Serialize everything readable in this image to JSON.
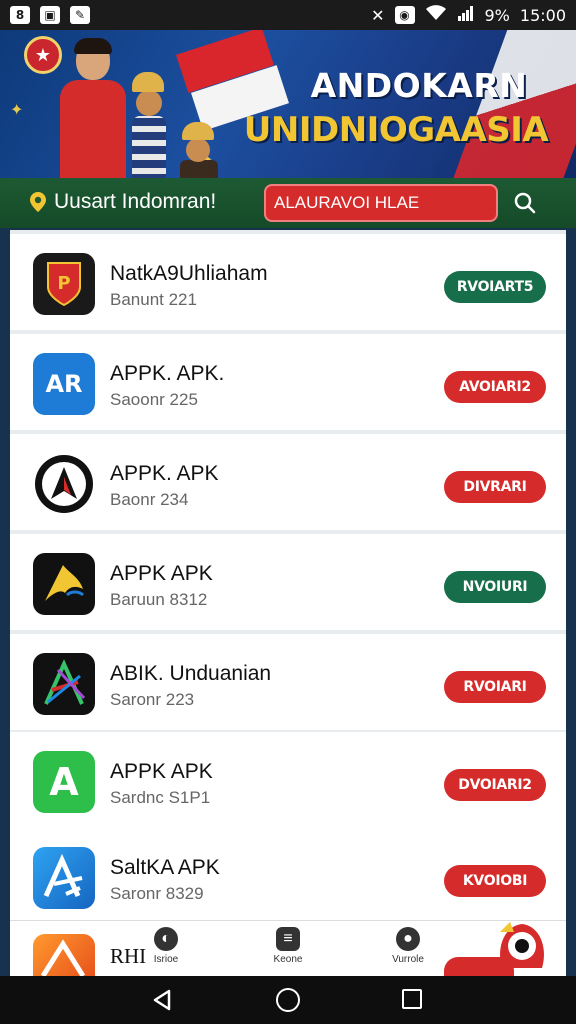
{
  "status_bar": {
    "right_text": "9%",
    "time": "15:00",
    "left_icons": [
      "notification-icon",
      "image-icon",
      "edit-icon"
    ],
    "right_icons": [
      "mute-icon",
      "alarm-icon",
      "wifi-icon",
      "signal-icon"
    ]
  },
  "banner": {
    "title_line1": "ANDOKARN",
    "title_line2": "UNIDNIOGAASIA"
  },
  "search_bar": {
    "greeting": "Uusart Indomran!",
    "search_value": "ALAURAVOI HLAE",
    "location_icon": "location-pin-icon",
    "search_icon": "search-icon"
  },
  "apps": [
    {
      "name": "NatkA9Uhliaham",
      "subtitle": "Banunt 221",
      "button": "RVOIART5",
      "button_color": "#176e4a",
      "icon_bg": "#1a1a1a",
      "icon_fg": "#d62b2b",
      "icon_glyph": "P"
    },
    {
      "name": "APPK. APK.",
      "subtitle": "Saoonr 225",
      "button": "AVOIARI2",
      "button_color": "#d62b2b",
      "icon_bg": "#1e7bd6",
      "icon_fg": "#ffffff",
      "icon_glyph": "AR"
    },
    {
      "name": "APPK. APK",
      "subtitle": "Baonr 234",
      "button": "DIVRARI",
      "button_color": "#d62b2b",
      "icon_bg": "#ffffff",
      "icon_fg": "#111111",
      "icon_glyph": "A"
    },
    {
      "name": "APPK APK",
      "subtitle": "Baruun 8312",
      "button": "NVOIURI",
      "button_color": "#176e4a",
      "icon_bg": "#111111",
      "icon_fg": "#f2c533",
      "icon_glyph": "A"
    },
    {
      "name": "ABIK. Unduanian",
      "subtitle": "Saronr 223",
      "button": "RVOIARI",
      "button_color": "#d62b2b",
      "icon_bg": "#111111",
      "icon_fg": "#36c46b",
      "icon_glyph": "A"
    },
    {
      "name": "APPK APK",
      "subtitle": "Sardnc S1P1",
      "button": "DVOIARI2",
      "button_color": "#d62b2b",
      "icon_bg": "#2dbf4a",
      "icon_fg": "#ffffff",
      "icon_glyph": "A"
    },
    {
      "name": "SaltKA APK",
      "subtitle": "Saronr 8329",
      "button": "KVOIOBI",
      "button_color": "#d62b2b",
      "icon_bg": "#1e88e5",
      "icon_fg": "#ffffff",
      "icon_glyph": "A"
    }
  ],
  "partial_app": {
    "name": "RHI"
  },
  "tab_bar": {
    "tabs": [
      {
        "label": "Isrioe",
        "icon": "home-icon"
      },
      {
        "label": "Keone",
        "icon": "list-icon"
      },
      {
        "label": "Vurrole",
        "icon": "profile-icon"
      }
    ]
  },
  "nav": {
    "back_icon": "back-icon",
    "home_icon": "home-circle-icon",
    "recents_icon": "recents-icon"
  }
}
